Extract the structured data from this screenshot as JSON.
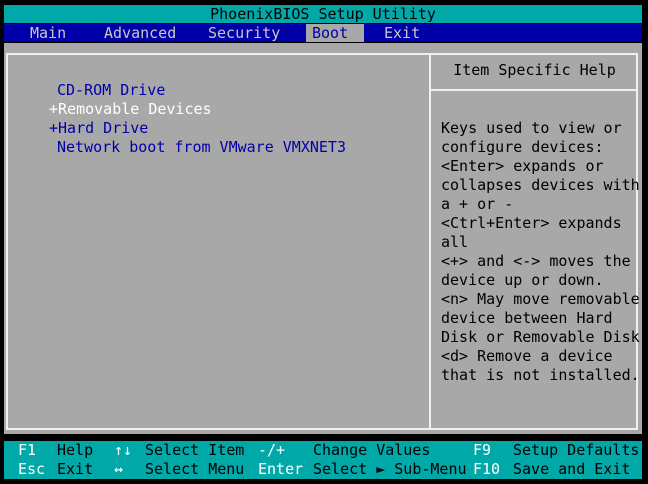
{
  "title": "PhoenixBIOS Setup Utility",
  "menu": {
    "main": "Main",
    "advanced": "Advanced",
    "security": "Security",
    "boot": "Boot",
    "exit": "Exit"
  },
  "boot_items": [
    "CD-ROM Drive",
    "+Removable Devices",
    "+Hard Drive",
    "Network boot from VMware VMXNET3"
  ],
  "help": {
    "title": "Item Specific Help",
    "lines": [
      "Keys used to view or",
      "configure devices:",
      "<Enter> expands or",
      "collapses devices with",
      "a + or -",
      "<Ctrl+Enter> expands",
      "all",
      "<+> and <-> moves the",
      "device up or down.",
      "<n> May move removable",
      "device between Hard",
      "Disk or Removable Disk",
      "<d> Remove a device",
      "that is not installed."
    ]
  },
  "footer": {
    "row1": [
      {
        "key": "F1",
        "desc": "Help"
      },
      {
        "key": "↑↓",
        "desc": "Select Item"
      },
      {
        "key": "-/+",
        "desc": "Change Values"
      },
      {
        "key": "F9",
        "desc": "Setup Defaults"
      }
    ],
    "row2": [
      {
        "key": "Esc",
        "desc": "Exit"
      },
      {
        "key": "↔",
        "desc": "Select Menu"
      },
      {
        "key": "Enter",
        "desc": "Select ► Sub-Menu"
      },
      {
        "key": "F10",
        "desc": "Save and Exit"
      }
    ]
  },
  "colors": {
    "cyan": "#00a8a8",
    "blue": "#0000a8",
    "gray": "#a8a8a8",
    "white": "#ffffff"
  }
}
